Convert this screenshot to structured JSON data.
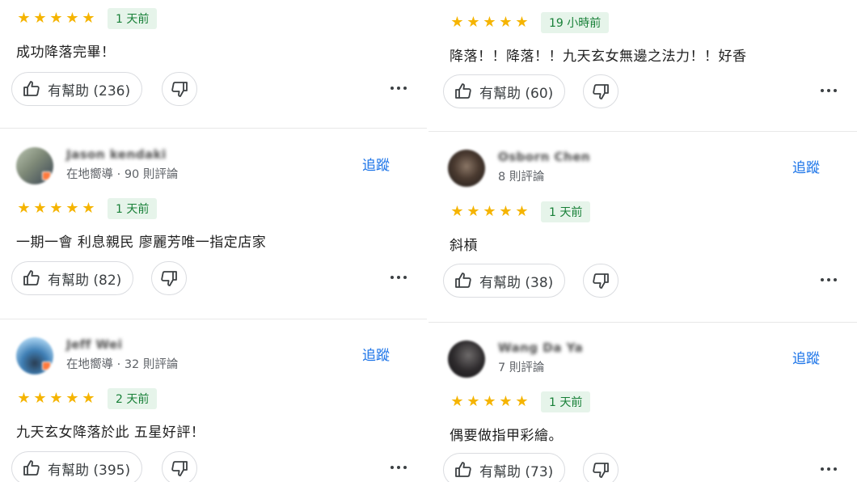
{
  "common": {
    "stars": "★★★★★",
    "follow_label": "追蹤"
  },
  "colors": {
    "star": "#f5b400",
    "badge_bg": "#e6f4ea",
    "badge_text": "#188038",
    "follow": "#1a73e8"
  },
  "icons": {
    "helpful": "thumb-up-icon",
    "not_helpful": "thumb-down-icon",
    "more": "more-horizontal-icon"
  },
  "left": [
    {
      "time": "1 天前",
      "text": "成功降落完畢！",
      "helpful": "有幫助 (236)"
    },
    {
      "name": "Jason kendaki",
      "meta": "在地嚮導 · 90 則評論",
      "time": "1 天前",
      "text": "一期一會 利息親民 廖麗芳唯一指定店家",
      "helpful": "有幫助 (82)"
    },
    {
      "name": "Jeff Wei",
      "meta": "在地嚮導 · 32 則評論",
      "time": "2 天前",
      "text": "九天玄女降落於此 五星好評！",
      "helpful": "有幫助 (395)"
    }
  ],
  "right": [
    {
      "time": "19 小時前",
      "text": "降落！！降落！！九天玄女無邊之法力！！好香",
      "helpful": "有幫助 (60)"
    },
    {
      "name": "Osborn Chen",
      "meta": "8 則評論",
      "time": "1 天前",
      "text": "斜槓",
      "helpful": "有幫助 (38)"
    },
    {
      "name": "Wang Da Ya",
      "meta": "7 則評論",
      "time": "1 天前",
      "text": "偶要做指甲彩繪。",
      "helpful": "有幫助 (73)"
    }
  ]
}
